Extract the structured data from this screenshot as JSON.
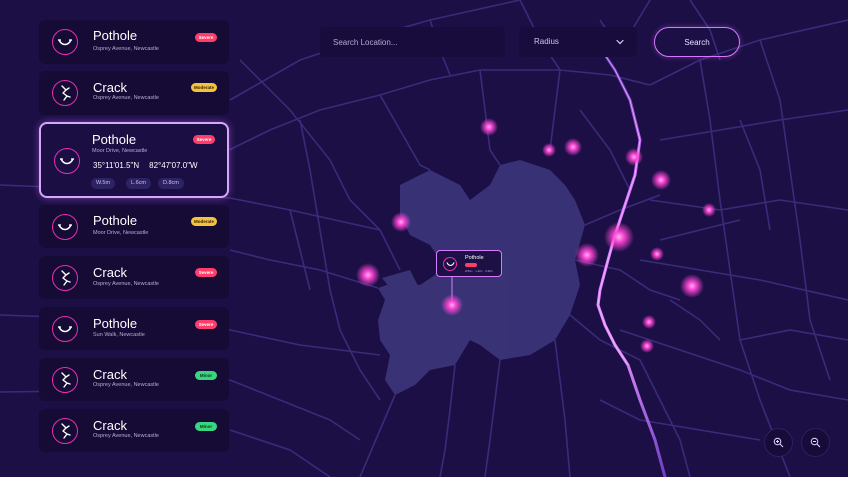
{
  "colors": {
    "background": "#1c0f45",
    "road": "#3a2b7a",
    "urban_area": "#3b3478",
    "highway": "#b56cff",
    "hotspot": "#ff45d6",
    "severe": "#ff3d6a",
    "moderate": "#f4c23e",
    "minor": "#3ad67f"
  },
  "search": {
    "placeholder": "Search Location...",
    "button_label": "Search"
  },
  "radius": {
    "selected": "Radius"
  },
  "reports": [
    {
      "title": "Pothole",
      "location": "Osprey Avenue, Newcastle",
      "severity": "Severe",
      "level": "severe",
      "icon": "pothole-icon"
    },
    {
      "title": "Crack",
      "location": "Osprey Avenue, Newcastle",
      "severity": "Moderate",
      "level": "moderate",
      "icon": "crack-icon"
    },
    {
      "title": "Pothole",
      "location": "Moor Drive, Newcastle",
      "severity": "Severe",
      "level": "severe",
      "icon": "pothole-icon",
      "lat": "35°11'01.5\"N",
      "lon": "82°47'07.0\"W",
      "chips": [
        "W.5m",
        "L.6cm",
        "D.8cm"
      ]
    },
    {
      "title": "Pothole",
      "location": "Moor Drive, Newcastle",
      "severity": "Moderate",
      "level": "moderate",
      "icon": "pothole-icon"
    },
    {
      "title": "Crack",
      "location": "Osprey Avenue, Newcastle",
      "severity": "Severe",
      "level": "severe",
      "icon": "crack-icon"
    },
    {
      "title": "Pothole",
      "location": "Sun Walk, Newcastle",
      "severity": "Severe",
      "level": "severe",
      "icon": "pothole-icon"
    },
    {
      "title": "Crack",
      "location": "Osprey Avenue, Newcastle",
      "severity": "Minor",
      "level": "minor",
      "icon": "crack-icon"
    },
    {
      "title": "Crack",
      "location": "Osprey Avenue, Newcastle",
      "severity": "Minor",
      "level": "minor",
      "icon": "crack-icon"
    }
  ],
  "popup": {
    "title": "Pothole",
    "severity_level": "severe",
    "tags": [
      "W.5cm",
      "L.6cm",
      "D.8cm"
    ],
    "icon": "pothole-icon"
  },
  "zoom": {
    "in_icon": "zoom-in-icon",
    "out_icon": "zoom-out-icon"
  }
}
